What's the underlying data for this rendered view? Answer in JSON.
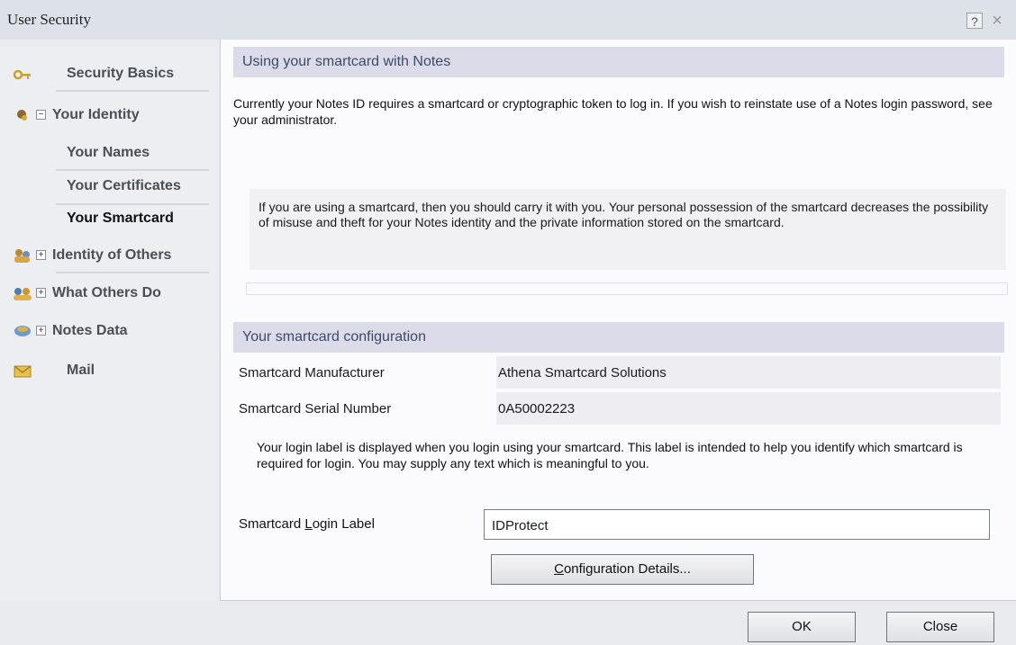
{
  "window": {
    "title": "User Security",
    "help_label": "?",
    "close_label": "×"
  },
  "sidebar": {
    "items": [
      {
        "label": "Security Basics"
      },
      {
        "label": "Your Identity",
        "toggle": "−"
      },
      {
        "label": "Your Names"
      },
      {
        "label": "Your Certificates"
      },
      {
        "label": "Your Smartcard"
      },
      {
        "label": "Identity of Others",
        "toggle": "+"
      },
      {
        "label": "What Others Do",
        "toggle": "+"
      },
      {
        "label": "Notes Data",
        "toggle": "+"
      },
      {
        "label": "Mail"
      }
    ]
  },
  "section1": {
    "title": "Using your smartcard with Notes",
    "intro": "Currently your Notes ID requires a smartcard or cryptographic token to log in.  If you wish to reinstate use of a Notes login password, see your administrator.",
    "info": "If you are using a smartcard, then you should carry it with you.  Your personal possession of the smartcard decreases the possibility of misuse and theft for your Notes identity and the private information stored on the smartcard."
  },
  "section2": {
    "title": "Your smartcard configuration",
    "manufacturer_label": "Smartcard Manufacturer",
    "manufacturer_value": "Athena Smartcard Solutions",
    "serial_label": "Smartcard Serial Number",
    "serial_value": "0A50002223",
    "login_note": "Your login label is displayed when you login using your smartcard.  This label is intended to help you identify which smartcard is required for login.  You may supply any text which is meaningful to you.",
    "login_label_pre": "Smartcard ",
    "login_label_key": "L",
    "login_label_post": "ogin Label",
    "login_value": "IDProtect",
    "config_pre": "",
    "config_key": "C",
    "config_post": "onfiguration Details..."
  },
  "footer": {
    "ok_label": "OK",
    "close_label": "Close"
  }
}
